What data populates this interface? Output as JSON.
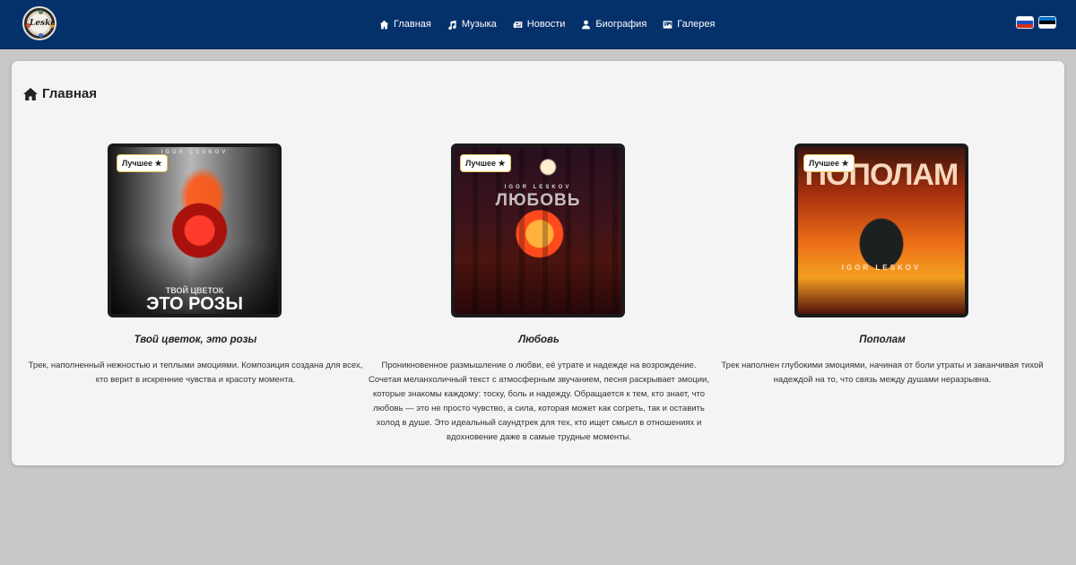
{
  "nav": {
    "items": [
      {
        "label": "Главная",
        "icon": "home-icon"
      },
      {
        "label": "Музыка",
        "icon": "music-icon"
      },
      {
        "label": "Новости",
        "icon": "newspaper-icon"
      },
      {
        "label": "Биография",
        "icon": "user-icon"
      },
      {
        "label": "Галерея",
        "icon": "image-icon"
      }
    ],
    "languages": [
      "flag-russia",
      "flag-estonia"
    ],
    "colors": {
      "navbar": "#05316b",
      "text": "#ffffff"
    }
  },
  "logo": {
    "text": "Leskov"
  },
  "page": {
    "title": "Главная"
  },
  "tracks": [
    {
      "badge": "Лучшее ★",
      "cover_small_text": "ТВОЙ ЦВЕТОК",
      "cover_title": "ЭТО РОЗЫ",
      "cover_artist": "IGOR LESKOV",
      "title": "Твой цветок, это розы",
      "description": "Трек, наполненный нежностью и теплыми эмоциями. Композиция создана для всех, кто верит в искренние чувства и красоту момента."
    },
    {
      "badge": "Лучшее ★",
      "cover_artist": "IGOR LESKOV",
      "cover_title": "ЛЮБОВЬ",
      "title": "Любовь",
      "description": "Проникновенное размышление о любви, её утрате и надежде на возрождение. Сочетая меланхоличный текст с атмосферным звучанием, песня раскрывает эмоции, которые знакомы каждому: тоску, боль и надежду. Обращается к тем, кто знает, что любовь — это не просто чувство, а сила, которая может как согреть, так и оставить холод в душе. Это идеальный саундтрек для тех, кто ищет смысл в отношениях и вдохновение даже в самые трудные моменты."
    },
    {
      "badge": "Лучшее ★",
      "cover_title": "ПОПОЛАМ",
      "cover_artist": "IGOR LESKOV",
      "title": "Пополам",
      "description": "Трек наполнен глубокими эмоциями, начиная от боли утраты и заканчивая тихой надеждой на то, что связь между душами неразрывна."
    }
  ]
}
